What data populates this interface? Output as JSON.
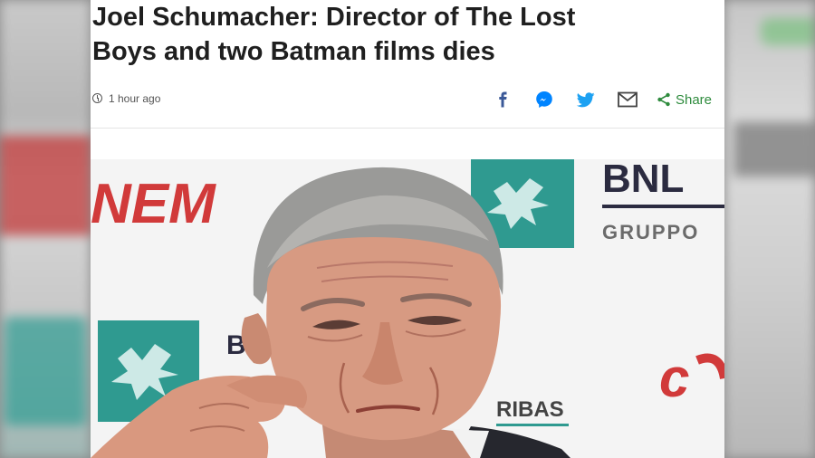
{
  "article": {
    "headline_line1": "Joel Schumacher: Director of The Lost",
    "headline_line2": "Boys and two Batman films dies",
    "timestamp": "1 hour ago"
  },
  "share": {
    "icons": [
      "facebook-icon",
      "messenger-icon",
      "twitter-icon",
      "email-icon"
    ],
    "label": "Share"
  },
  "photo": {
    "backdrop_text_left": "NEM",
    "backdrop_logo_top": "BNL",
    "backdrop_logo_sub": "GRUPPO",
    "backdrop_text_bottom": "RIBAS",
    "backdrop_text_right": "c",
    "backdrop_text_mid": "B"
  },
  "colors": {
    "share_green": "#2e8b3d",
    "facebook_blue": "#3b5998",
    "messenger_blue": "#0084ff",
    "twitter_blue": "#1da1f2",
    "teal_logo": "#2f9a90",
    "cinema_red": "#d13a3a"
  }
}
